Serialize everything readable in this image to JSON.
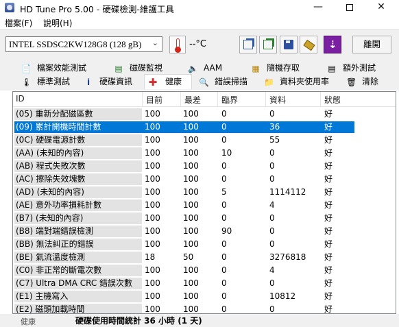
{
  "window": {
    "title": "HD Tune Pro  5.00 - 硬碟檢測-維護工具",
    "minimize_glyph": "—",
    "close_glyph": "✕"
  },
  "menu": {
    "file": "檔案(F)",
    "help": "說明(H)"
  },
  "toolbar": {
    "drive": "INTEL SSDSC2KW128G8 (128 gB)",
    "temperature": "--°C",
    "exit_label": "離開",
    "icons": [
      "copy-text-icon",
      "copy-screen-icon",
      "save-icon",
      "options-icon",
      "download-icon"
    ]
  },
  "tabs": {
    "row1": [
      "檔案效能測試",
      "磁碟監視",
      "AAM",
      "隨機存取",
      "額外測試"
    ],
    "row2": [
      "標準測試",
      "硬碟資訊",
      "健康",
      "錯誤掃描",
      "資料夾使用率",
      "清除"
    ],
    "active": "健康"
  },
  "table": {
    "columns": [
      "ID",
      "目前",
      "最差",
      "臨界",
      "資料",
      "狀態"
    ],
    "selected_index": 1,
    "rows": [
      {
        "id": "(05) 重新分配磁區數",
        "current": "100",
        "worst": "100",
        "threshold": "0",
        "data": "0",
        "status": "好"
      },
      {
        "id": "(09) 累計開機時間計數",
        "current": "100",
        "worst": "100",
        "threshold": "0",
        "data": "36",
        "status": "好"
      },
      {
        "id": "(0C) 硬碟電源計數",
        "current": "100",
        "worst": "100",
        "threshold": "0",
        "data": "55",
        "status": "好"
      },
      {
        "id": "(AA) (未知的內容)",
        "current": "100",
        "worst": "100",
        "threshold": "10",
        "data": "0",
        "status": "好"
      },
      {
        "id": "(AB) 程式失敗次數",
        "current": "100",
        "worst": "100",
        "threshold": "0",
        "data": "0",
        "status": "好"
      },
      {
        "id": "(AC) 擦除失效塊數",
        "current": "100",
        "worst": "100",
        "threshold": "0",
        "data": "0",
        "status": "好"
      },
      {
        "id": "(AD) (未知的內容)",
        "current": "100",
        "worst": "100",
        "threshold": "5",
        "data": "1114112",
        "status": "好"
      },
      {
        "id": "(AE) 意外功率損耗計數",
        "current": "100",
        "worst": "100",
        "threshold": "0",
        "data": "4",
        "status": "好"
      },
      {
        "id": "(B7) (未知的內容)",
        "current": "100",
        "worst": "100",
        "threshold": "0",
        "data": "0",
        "status": "好"
      },
      {
        "id": "(B8) 端對端錯誤檢測",
        "current": "100",
        "worst": "100",
        "threshold": "90",
        "data": "0",
        "status": "好"
      },
      {
        "id": "(BB) 無法糾正的錯誤",
        "current": "100",
        "worst": "100",
        "threshold": "0",
        "data": "0",
        "status": "好"
      },
      {
        "id": "(BE) 氣流溫度檢測",
        "current": "18",
        "worst": "50",
        "threshold": "0",
        "data": "3276818",
        "status": "好"
      },
      {
        "id": "(C0) 非正常的斷電次數",
        "current": "100",
        "worst": "100",
        "threshold": "0",
        "data": "4",
        "status": "好"
      },
      {
        "id": "(C7) Ultra DMA CRC 錯誤次數",
        "current": "100",
        "worst": "100",
        "threshold": "0",
        "data": "0",
        "status": "好"
      },
      {
        "id": "(E1) 主機寫入",
        "current": "100",
        "worst": "100",
        "threshold": "0",
        "data": "10812",
        "status": "好"
      },
      {
        "id": "(E2) 磁頭加載時間",
        "current": "100",
        "worst": "100",
        "threshold": "0",
        "data": "0",
        "status": "好"
      }
    ]
  },
  "status": {
    "left": "健康",
    "text": "硬碟使用時間統計 36 小時 (1 天)"
  }
}
